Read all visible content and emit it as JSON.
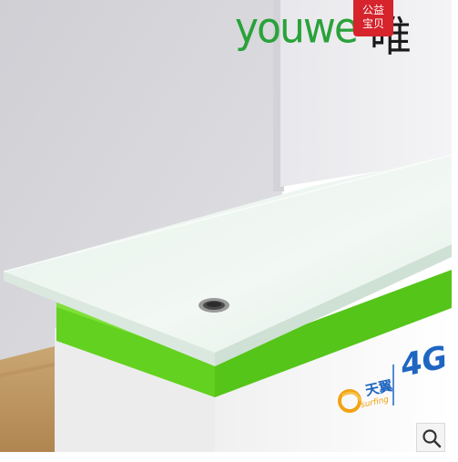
{
  "watermark": {
    "latin": "youwe",
    "cjk": "唯",
    "badge_line1": "公益",
    "badge_line2": "宝贝"
  },
  "cabinet_print": {
    "brand_cn": "天翼",
    "brand_en": "surfing",
    "network": "4G"
  },
  "colors": {
    "wall": "#d8d8dc",
    "wall_shadow": "#c2c2c8",
    "desktop_top": "#eef6f0",
    "accent_green": "#5ccb1e",
    "floor": "#c8a06a"
  },
  "icons": [
    "zoom-icon",
    "cable-grommet"
  ]
}
